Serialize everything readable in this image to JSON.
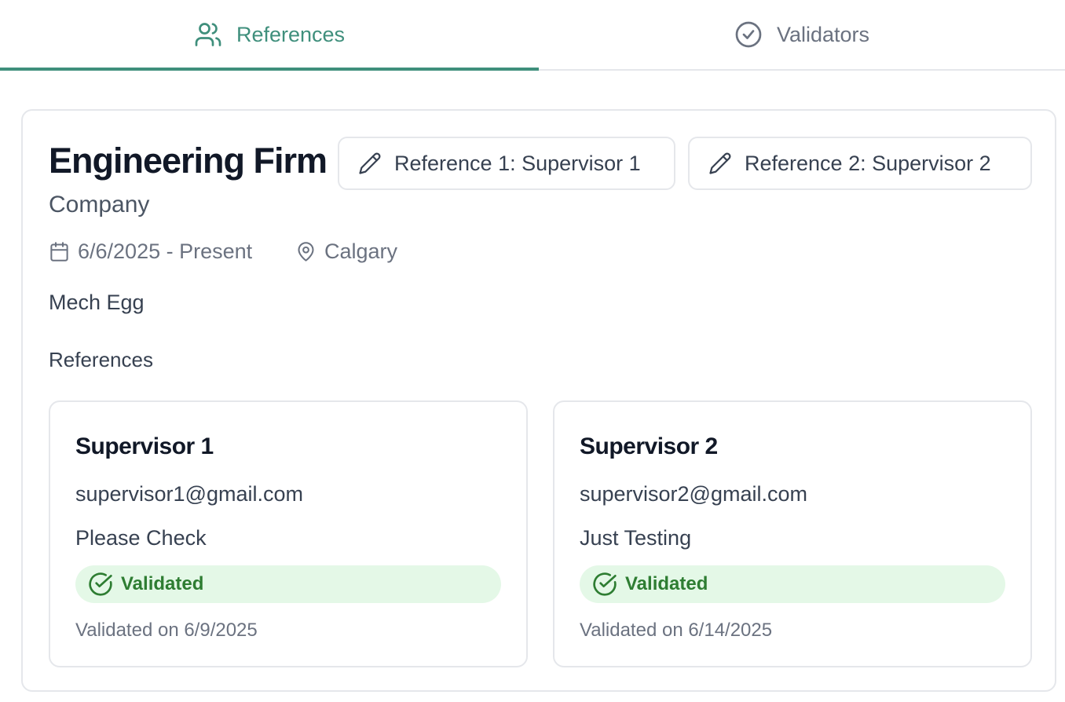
{
  "tabs": {
    "references": {
      "label": "References",
      "icon": "users-icon",
      "active": true
    },
    "validators": {
      "label": "Validators",
      "icon": "check-circle-icon",
      "active": false
    }
  },
  "colors": {
    "accent": "#3f8f7c",
    "badge_bg": "#e4f8e7",
    "badge_text": "#2e7d32"
  },
  "experience": {
    "title": "Engineering Firm",
    "type": "Company",
    "date_range": "6/6/2025 - Present",
    "location": "Calgary",
    "description": "Mech Egg",
    "buttons": [
      {
        "label": "Reference 1: Supervisor 1",
        "icon": "pencil-icon"
      },
      {
        "label": "Reference 2: Supervisor 2",
        "icon": "pencil-icon"
      }
    ],
    "references_label": "References",
    "references": [
      {
        "name": "Supervisor 1",
        "email": "supervisor1@gmail.com",
        "note": "Please Check",
        "status": "Validated",
        "validated_on": "Validated on 6/9/2025"
      },
      {
        "name": "Supervisor 2",
        "email": "supervisor2@gmail.com",
        "note": "Just Testing",
        "status": "Validated",
        "validated_on": "Validated on 6/14/2025"
      }
    ]
  }
}
